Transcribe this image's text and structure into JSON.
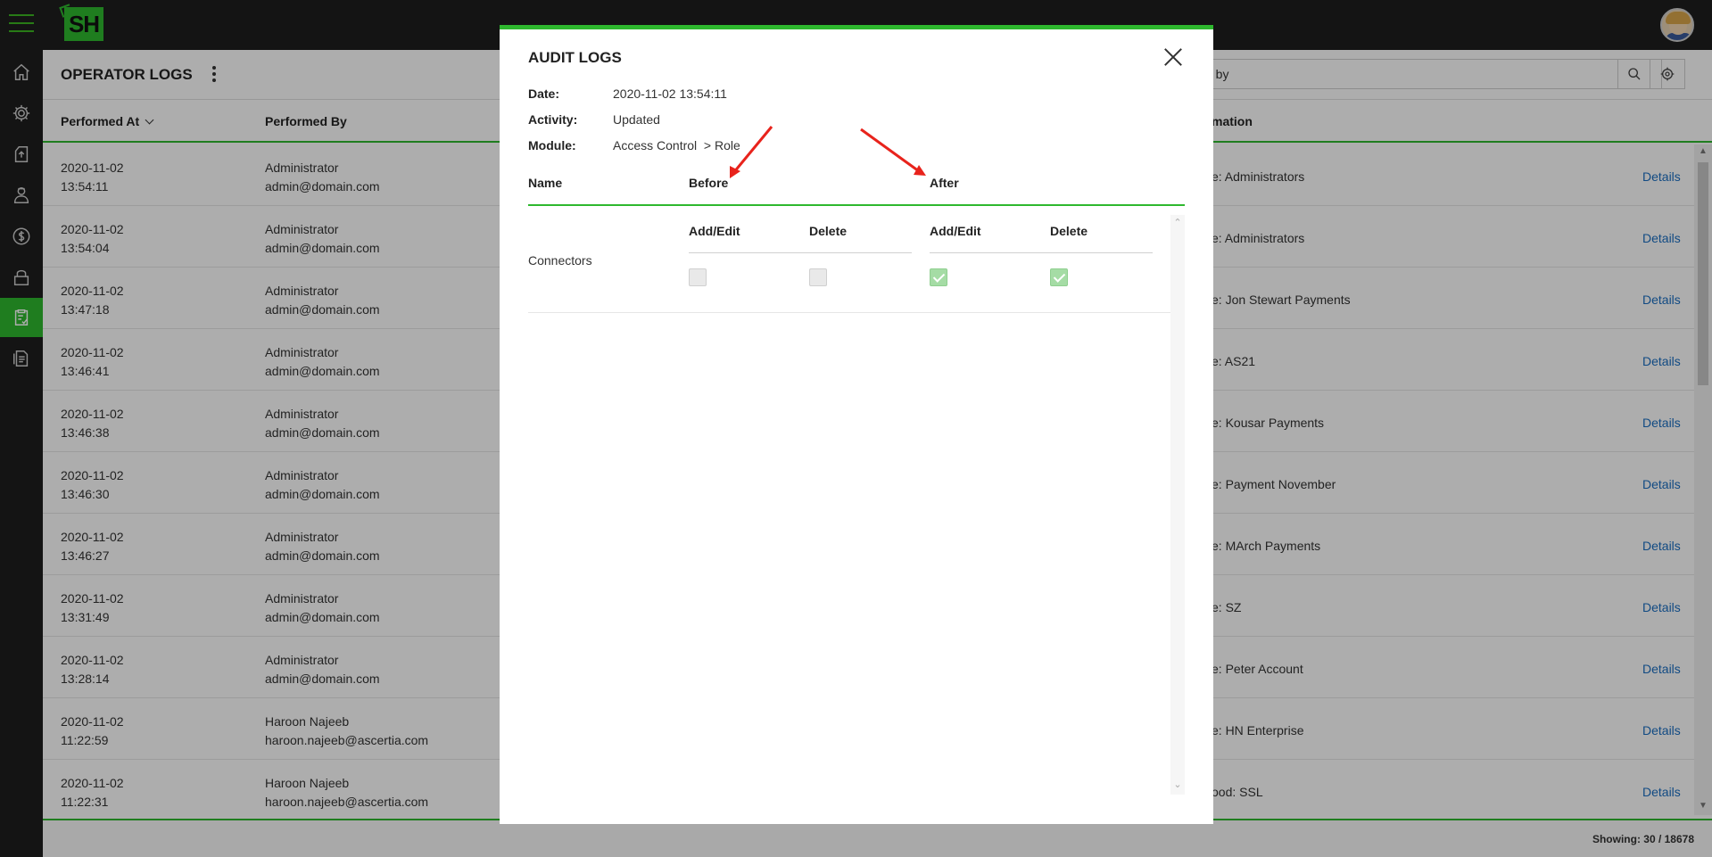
{
  "app": {
    "logo_text": "SH"
  },
  "sidebar": {
    "items": [
      {
        "name": "home-icon"
      },
      {
        "name": "gear-icon"
      },
      {
        "name": "upload-box-icon"
      },
      {
        "name": "operator-icon"
      },
      {
        "name": "dollar-icon"
      },
      {
        "name": "lock-icon"
      },
      {
        "name": "clipboard-check-icon",
        "active": true
      },
      {
        "name": "report-icon"
      }
    ],
    "accent": "#2eb82e"
  },
  "page": {
    "title": "OPERATOR LOGS",
    "search_value": "d by",
    "columns": [
      "Performed At",
      "Performed By",
      "mation"
    ],
    "details_label": "Details",
    "rows": [
      {
        "date": "2020-11-02",
        "time": "13:54:11",
        "by": "Administrator",
        "email": "admin@domain.com",
        "info": "e: Administrators"
      },
      {
        "date": "2020-11-02",
        "time": "13:54:04",
        "by": "Administrator",
        "email": "admin@domain.com",
        "info": "e: Administrators"
      },
      {
        "date": "2020-11-02",
        "time": "13:47:18",
        "by": "Administrator",
        "email": "admin@domain.com",
        "info": "e: Jon Stewart Payments"
      },
      {
        "date": "2020-11-02",
        "time": "13:46:41",
        "by": "Administrator",
        "email": "admin@domain.com",
        "info": "e: AS21"
      },
      {
        "date": "2020-11-02",
        "time": "13:46:38",
        "by": "Administrator",
        "email": "admin@domain.com",
        "info": "e: Kousar Payments"
      },
      {
        "date": "2020-11-02",
        "time": "13:46:30",
        "by": "Administrator",
        "email": "admin@domain.com",
        "info": "e: Payment November"
      },
      {
        "date": "2020-11-02",
        "time": "13:46:27",
        "by": "Administrator",
        "email": "admin@domain.com",
        "info": "e: MArch Payments"
      },
      {
        "date": "2020-11-02",
        "time": "13:31:49",
        "by": "Administrator",
        "email": "admin@domain.com",
        "info": "e: SZ"
      },
      {
        "date": "2020-11-02",
        "time": "13:28:14",
        "by": "Administrator",
        "email": "admin@domain.com",
        "info": "e: Peter Account"
      },
      {
        "date": "2020-11-02",
        "time": "11:22:59",
        "by": "Haroon Najeeb",
        "email": "haroon.najeeb@ascertia.com",
        "info": "e: HN Enterprise"
      },
      {
        "date": "2020-11-02",
        "time": "11:22:31",
        "by": "Haroon Najeeb",
        "email": "haroon.najeeb@ascertia.com",
        "info": "ood: SSL"
      }
    ],
    "footer_text": "Showing: 30 / 18678"
  },
  "modal": {
    "title": "AUDIT LOGS",
    "date_label": "Date:",
    "date_value": "2020-11-02 13:54:11",
    "activity_label": "Activity:",
    "activity_value": "Updated",
    "module_label": "Module:",
    "module_value": "Access Control  > Role",
    "col_name": "Name",
    "col_before": "Before",
    "col_after": "After",
    "perm_add_edit": "Add/Edit",
    "perm_delete": "Delete",
    "row_name": "Connectors",
    "before": {
      "add_edit": false,
      "delete": false
    },
    "after": {
      "add_edit": true,
      "delete": true
    },
    "annotation_color": "#e8231c"
  }
}
